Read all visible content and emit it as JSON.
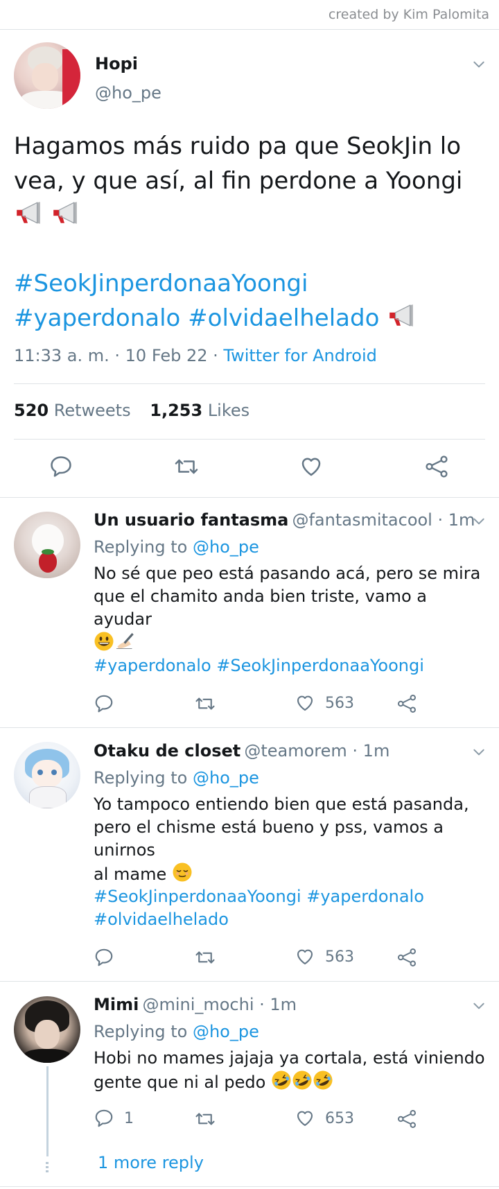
{
  "credit": "created by Kim Palomita",
  "main_tweet": {
    "display_name": "Hopi",
    "handle": "@ho_pe",
    "text_line1": "Hagamos más ruido pa que SeokJin lo",
    "text_line2": "vea, y que así, al fin perdone a Yoongi",
    "hashtag1": "#SeokJinperdonaaYoongi",
    "hashtag2": "#yaperdonalo",
    "hashtag3": "#olvidaelhelado",
    "time": "11:33 a. m. · 10 Feb 22 · ",
    "source": "Twitter for Android",
    "retweets_count": "520",
    "retweets_label": "Retweets",
    "likes_count": "1,253",
    "likes_label": "Likes"
  },
  "replies": [
    {
      "display_name": "Un usuario fantasma",
      "meta": "@fantasmitacool · 1m",
      "replying_label": "Replying to ",
      "replying_handle": "@ho_pe",
      "line1": "No sé que peo está pasando acá, pero se mira",
      "line2": "que el chamito anda bien triste, vamo a ayudar",
      "tags_line1": "#yaperdonalo #SeokJinperdonaaYoongi",
      "likes": "563"
    },
    {
      "display_name": "Otaku de closet",
      "meta": "@teamorem · 1m",
      "replying_label": "Replying to ",
      "replying_handle": "@ho_pe",
      "line1": "Yo tampoco entiendo bien que está pasanda,",
      "line2": "pero el chisme está bueno y pss, vamos a unirnos",
      "line3": "al mame",
      "tags_line1": "#SeokJinperdonaaYoongi #yaperdonalo",
      "tags_line2": "#olvidaelhelado",
      "likes": "563"
    },
    {
      "display_name": "Mimi",
      "meta": "@mini_mochi · 1m",
      "replying_label": "Replying to ",
      "replying_handle": "@ho_pe",
      "line1": "Hobi no mames jajaja ya cortala, está viniendo",
      "line2": "gente que ni al pedo",
      "replies": "1",
      "likes": "653",
      "more_reply": "1 more reply"
    }
  ],
  "icons": {
    "reply": "reply-bubble-icon",
    "retweet": "retweet-icon",
    "like": "heart-icon",
    "share": "share-icon",
    "chevron": "chevron-down-icon",
    "megaphone": "megaphone-emoji",
    "grin": "grinning-face-emoji",
    "writing": "writing-hand-emoji",
    "relieved": "relieved-face-emoji",
    "rofl": "rolling-laughing-emoji"
  },
  "colors": {
    "link": "#1b95e0",
    "divider": "#dfe3e6",
    "muted": "#657786"
  }
}
